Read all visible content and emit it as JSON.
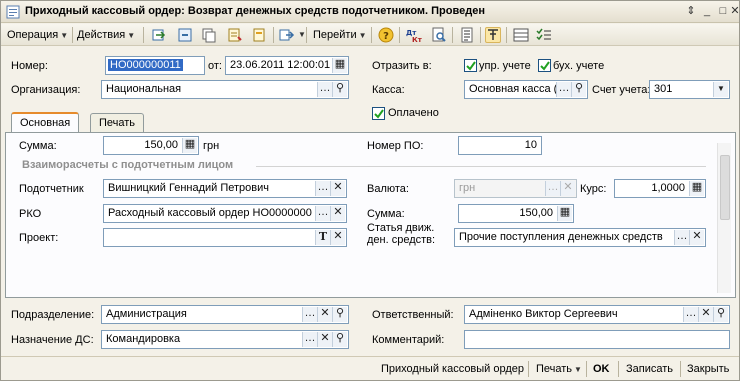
{
  "window": {
    "title": "Приходный кассовый ордер: Возврат денежных средств подотчетником. Проведен",
    "controls": {
      "pin": "⇕",
      "minimize": "_",
      "maximize": "□",
      "close": "✕"
    }
  },
  "toolbar": {
    "operation_label": "Операция",
    "actions_label": "Действия",
    "goto_label": "Перейти",
    "icons": [
      "post-icon",
      "post-and-close-icon",
      "copy-icon",
      "movements-icon",
      "document-icon",
      "structure-icon",
      "help-icon",
      "dtkt-icon",
      "preview-icon",
      "list-icon",
      "filter-icon",
      "columns-icon",
      "settings-icon"
    ]
  },
  "header": {
    "number_label": "Номер:",
    "number_value": "НО000000011",
    "date_label": "от:",
    "date_value": "23.06.2011 12:00:01",
    "reflect_label": "Отразить в:",
    "reflect_mgmt_label": "упр. учете",
    "reflect_mgmt_checked": true,
    "reflect_acc_label": "бух. учете",
    "reflect_acc_checked": true,
    "org_label": "Организация:",
    "org_value": "Национальная",
    "cashbox_label": "Касса:",
    "cashbox_value": "Основная касса (",
    "account_label": "Счет учета:",
    "account_value": "301",
    "paid_label": "Оплачено",
    "paid_checked": true
  },
  "tabs": [
    {
      "label": "Основная",
      "active": true
    },
    {
      "label": "Печать",
      "active": false
    }
  ],
  "main": {
    "sum_label": "Сумма:",
    "sum_value": "150,00",
    "sum_currency": "грн",
    "po_number_label": "Номер ПО:",
    "po_number_value": "10",
    "section_title": "Взаиморасчеты с подотчетным лицом",
    "person_label": "Подотчетник",
    "person_value": "Вишницкий Геннадий Петрович",
    "currency_label": "Валюта:",
    "currency_value": "грн",
    "rate_label": "Курс:",
    "rate_value": "1,0000",
    "rko_label": "РКО",
    "rko_value": "Расходный кассовый ордер НО0000000",
    "sum2_label": "Сумма:",
    "sum2_value": "150,00",
    "project_label": "Проект:",
    "project_value": "",
    "cashflow_label_line1": "Статья движ.",
    "cashflow_label_line2": "ден. средств:",
    "cashflow_value": "Прочие поступления денежных средств"
  },
  "bottom": {
    "department_label": "Подразделение:",
    "department_value": "Администрация",
    "responsible_label": "Ответственный:",
    "responsible_value": "Адміненко Виктор Сергеевич",
    "purpose_label": "Назначение ДС:",
    "purpose_value": "Командировка",
    "comment_label": "Комментарий:",
    "comment_value": ""
  },
  "footer": {
    "receipt_label": "Приходный кассовый ордер",
    "print_label": "Печать",
    "ok_label": "OK",
    "save_label": "Записать",
    "close_label": "Закрыть"
  },
  "colors": {
    "accent_tab": "#e68b2c",
    "selection": "#316ac5",
    "field_border": "#7f9db9",
    "section_text": "#8f8f8f"
  }
}
